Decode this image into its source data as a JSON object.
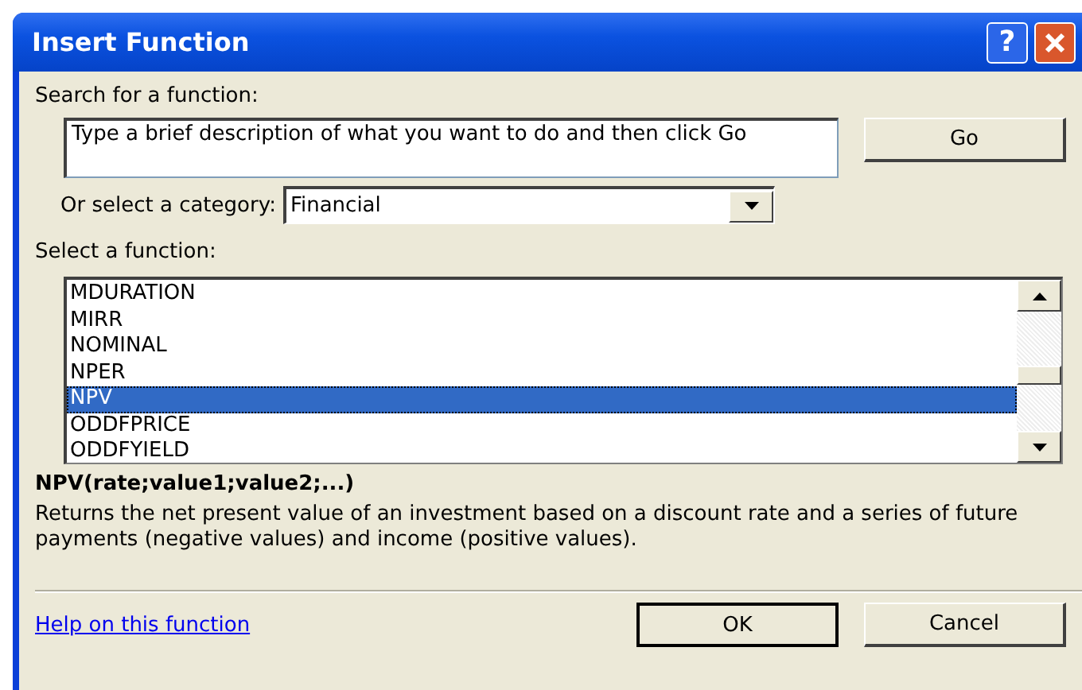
{
  "window": {
    "title": "Insert Function",
    "help_button": "?"
  },
  "search": {
    "label": "Search for a function:",
    "value": "Type a brief description of what you want to do and then click Go",
    "button": "Go"
  },
  "category": {
    "label": "Or select a category:",
    "value": "Financial"
  },
  "functions": {
    "label": "Select a function:",
    "items": [
      {
        "name": "MDURATION",
        "selected": false
      },
      {
        "name": "MIRR",
        "selected": false
      },
      {
        "name": "NOMINAL",
        "selected": false
      },
      {
        "name": "NPER",
        "selected": false
      },
      {
        "name": "NPV",
        "selected": true
      },
      {
        "name": "ODDFPRICE",
        "selected": false
      },
      {
        "name": "ODDFYIELD",
        "selected": false
      }
    ]
  },
  "signature": "NPV(rate;value1;value2;...)",
  "description": "Returns the net present value of an investment based on a discount rate and a series of future payments (negative values) and income (positive values).",
  "help_link": "Help on this function",
  "buttons": [
    "OK",
    "Cancel"
  ]
}
